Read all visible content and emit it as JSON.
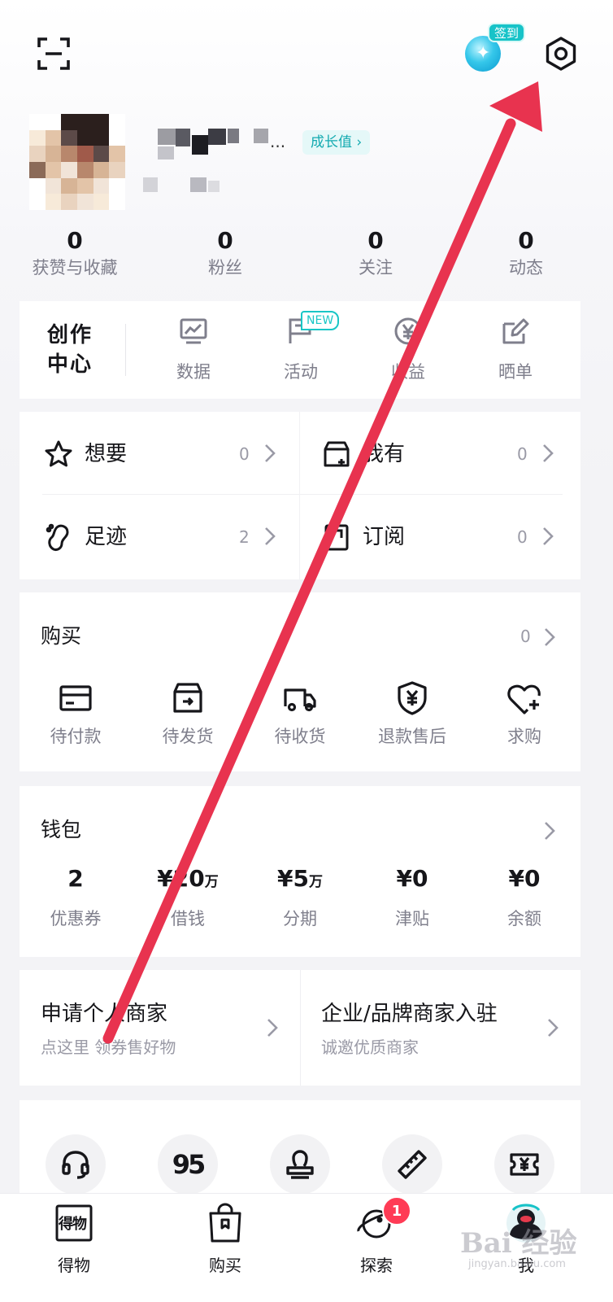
{
  "header": {
    "checkin_label": "签到",
    "checkin_glyph": "✦"
  },
  "profile": {
    "nickname_suffix": "...",
    "growth_label": "成长值 ›"
  },
  "stats": [
    {
      "value": "0",
      "label": "获赞与收藏"
    },
    {
      "value": "0",
      "label": "粉丝"
    },
    {
      "value": "0",
      "label": "关注"
    },
    {
      "value": "0",
      "label": "动态"
    }
  ],
  "creation_center": {
    "title_line1": "创作",
    "title_line2": "中心",
    "new_badge": "NEW",
    "items": [
      {
        "label": "数据",
        "icon": "chart-icon"
      },
      {
        "label": "活动",
        "icon": "flag-icon"
      },
      {
        "label": "收益",
        "icon": "yen-coin-icon"
      },
      {
        "label": "晒单",
        "icon": "edit-icon"
      }
    ]
  },
  "collections": [
    {
      "label": "想要",
      "count": "0",
      "icon": "star-icon"
    },
    {
      "label": "我有",
      "count": "0",
      "icon": "box-icon"
    },
    {
      "label": "足迹",
      "count": "2",
      "icon": "footprint-icon"
    },
    {
      "label": "订阅",
      "count": "0",
      "icon": "subscribe-icon"
    }
  ],
  "purchase": {
    "title": "购买",
    "count": "0",
    "items": [
      {
        "label": "待付款",
        "icon": "card-icon"
      },
      {
        "label": "待发货",
        "icon": "package-icon"
      },
      {
        "label": "待收货",
        "icon": "truck-icon"
      },
      {
        "label": "退款售后",
        "icon": "shield-yen-icon"
      },
      {
        "label": "求购",
        "icon": "heart-plus-icon"
      }
    ]
  },
  "wallet": {
    "title": "钱包",
    "items": [
      {
        "value": "2",
        "unit": "",
        "label": "优惠券"
      },
      {
        "value": "¥20",
        "unit": "万",
        "label": "借钱"
      },
      {
        "value": "¥5",
        "unit": "万",
        "label": "分期"
      },
      {
        "value": "¥0",
        "unit": "",
        "label": "津贴"
      },
      {
        "value": "¥0",
        "unit": "",
        "label": "余额"
      }
    ]
  },
  "merchant": {
    "personal_title": "申请个人商家",
    "personal_sub": "点这里 领券售好物",
    "enterprise_title": "企业/品牌商家入驻",
    "enterprise_sub": "诚邀优质商家"
  },
  "services": [
    {
      "icon": "headset-icon"
    },
    {
      "icon": "95-icon",
      "text": "95"
    },
    {
      "icon": "stamp-icon"
    },
    {
      "icon": "ruler-icon"
    },
    {
      "icon": "ticket-icon"
    }
  ],
  "bottom_nav": [
    {
      "label": "得物",
      "icon": "dewu-logo-icon",
      "icon_text": "得物"
    },
    {
      "label": "购买",
      "icon": "shopping-bag-icon"
    },
    {
      "label": "探索",
      "icon": "planet-icon",
      "badge": "1"
    },
    {
      "label": "我",
      "icon": "profile-avatar-icon"
    }
  ],
  "watermark": {
    "main": "Bai 经验",
    "sub": "jingyan.baidu.com"
  },
  "colors": {
    "accent": "#17c3c8",
    "annotation_arrow": "#e8334f",
    "badge_red": "#ff3b55"
  }
}
